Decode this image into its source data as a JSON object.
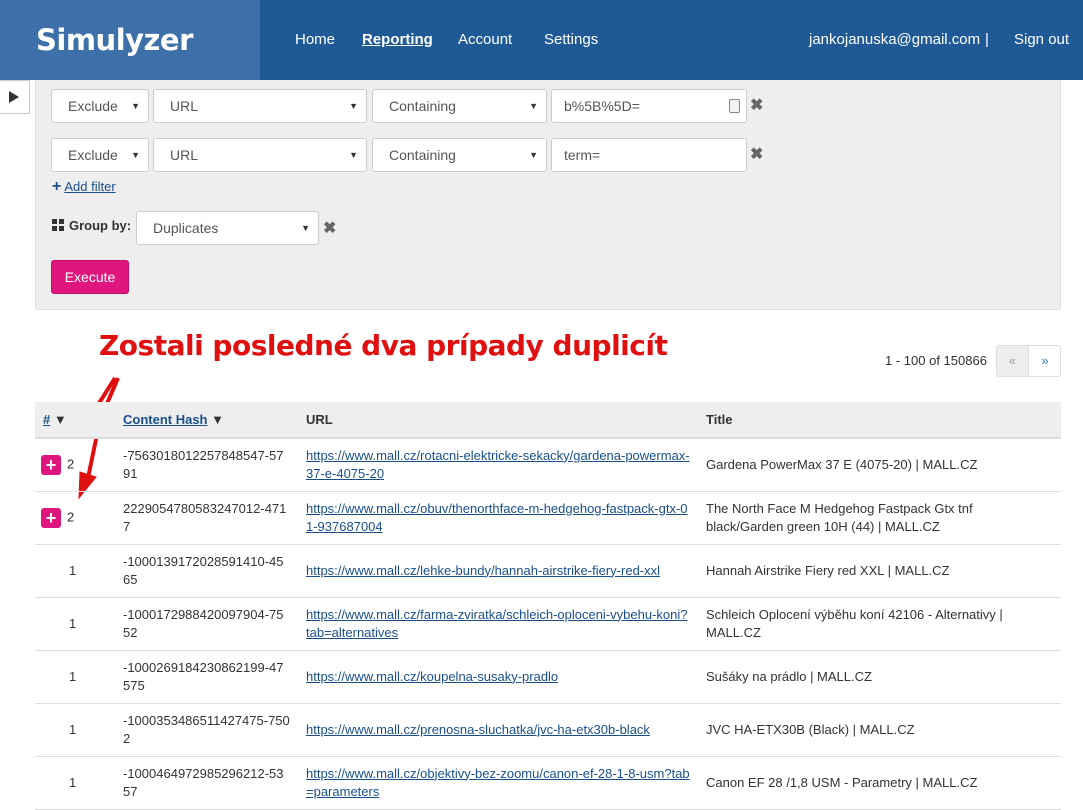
{
  "nav": {
    "brand": "Simulyzer",
    "links": [
      "Home",
      "Reporting",
      "Account",
      "Settings"
    ],
    "user": "jankojanuska@gmail.com",
    "separator": "|",
    "signout": "Sign out"
  },
  "filters": [
    {
      "mode": "Exclude",
      "field": "URL",
      "op": "Containing",
      "value": "b%5B%5D="
    },
    {
      "mode": "Exclude",
      "field": "URL",
      "op": "Containing",
      "value": "term="
    }
  ],
  "add_filter": "Add filter",
  "group_by": {
    "label": "Group by:",
    "value": "Duplicates"
  },
  "execute": "Execute",
  "annotation": "Zostali posledné dva prípady duplicít",
  "pagination": {
    "text": "1 - 100 of 150866",
    "prev": "«",
    "next": "»"
  },
  "table": {
    "headers": {
      "num": "#",
      "hash": "Content Hash",
      "url": "URL",
      "title": "Title"
    },
    "rows": [
      {
        "expand": true,
        "num": "2",
        "hash": "-7563018012257848547-5791",
        "url": "https://www.mall.cz/rotacni-elektricke-sekacky/gardena-powermax-37-e-4075-20",
        "title": "Gardena PowerMax 37 E (4075-20) | MALL.CZ"
      },
      {
        "expand": true,
        "num": "2",
        "hash": "2229054780583247012-4717",
        "url": "https://www.mall.cz/obuv/thenorthface-m-hedgehog-fastpack-gtx-01-937687004",
        "title": "The North Face M Hedgehog Fastpack Gtx tnf black/Garden green 10H (44) | MALL.CZ"
      },
      {
        "expand": false,
        "num": "1",
        "hash": "-1000139172028591410-4565",
        "url": "https://www.mall.cz/lehke-bundy/hannah-airstrike-fiery-red-xxl",
        "title": "Hannah Airstrike Fiery red XXL | MALL.CZ"
      },
      {
        "expand": false,
        "num": "1",
        "hash": "-1000172988420097904-7552",
        "url": "https://www.mall.cz/farma-zviratka/schleich-oploceni-vybehu-koni?tab=alternatives",
        "title": "Schleich Oplocení výběhu koní 42106 - Alternativy | MALL.CZ"
      },
      {
        "expand": false,
        "num": "1",
        "hash": "-1000269184230862199-47575",
        "url": "https://www.mall.cz/koupelna-susaky-pradlo",
        "title": "Sušáky na prádlo | MALL.CZ"
      },
      {
        "expand": false,
        "num": "1",
        "hash": "-1000353486511427475-7502",
        "url": "https://www.mall.cz/prenosna-sluchatka/jvc-ha-etx30b-black",
        "title": "JVC HA-ETX30B (Black) | MALL.CZ"
      },
      {
        "expand": false,
        "num": "1",
        "hash": "-1000464972985296212-5357",
        "url": "https://www.mall.cz/objektivy-bez-zoomu/canon-ef-28-1-8-usm?tab=parameters",
        "title": "Canon EF 28 /1,8 USM - Parametry | MALL.CZ"
      }
    ]
  },
  "colors": {
    "nav": "#1f5a96",
    "brand_bg": "#3d6fa8",
    "accent": "#e0167f",
    "annotation": "#e01010"
  }
}
